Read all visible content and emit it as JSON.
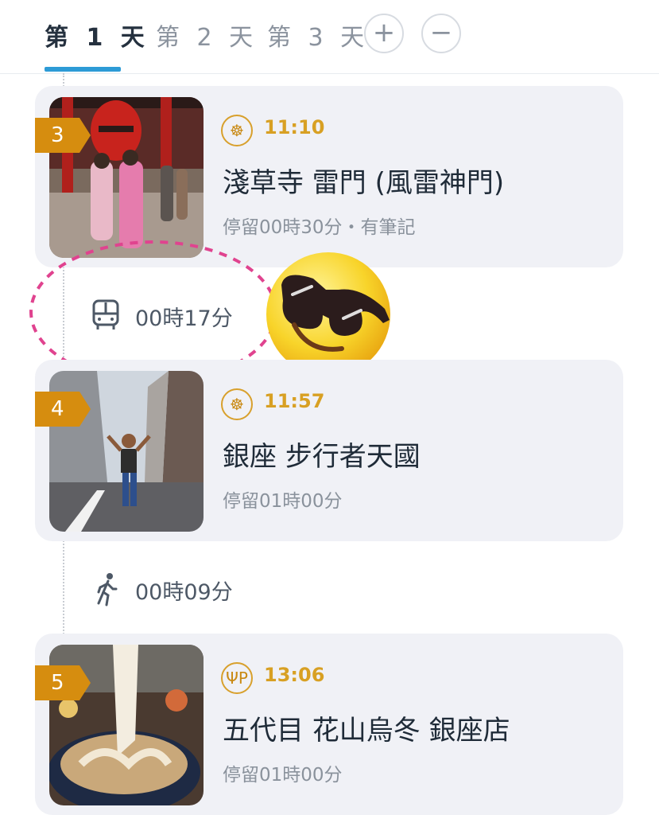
{
  "tabs": [
    {
      "label": "第 1 天",
      "active": true
    },
    {
      "label": "第 2 天",
      "active": false
    },
    {
      "label": "第 3 天",
      "active": false
    }
  ],
  "controls": {
    "add_label": "+",
    "remove_label": "−"
  },
  "stops": [
    {
      "number": "3",
      "category": "attraction-icon",
      "time": "11:10",
      "title": "淺草寺 雷門 (風雷神門)",
      "stay": "停留00時30分・有筆記"
    },
    {
      "number": "4",
      "category": "attraction-icon",
      "time": "11:57",
      "title": "銀座 步行者天國",
      "stay": "停留01時00分"
    },
    {
      "number": "5",
      "category": "restaurant-icon",
      "time": "13:06",
      "title": "五代目 花山烏冬 銀座店",
      "stay": "停留01時00分"
    }
  ],
  "transits": [
    {
      "mode": "bus-icon",
      "duration": "00時17分"
    },
    {
      "mode": "walk-icon",
      "duration": "00時09分"
    }
  ],
  "colors": {
    "accent": "#2d9bd6",
    "badge": "#d68d0f",
    "time": "#d8a023",
    "card": "#f0f1f6"
  }
}
